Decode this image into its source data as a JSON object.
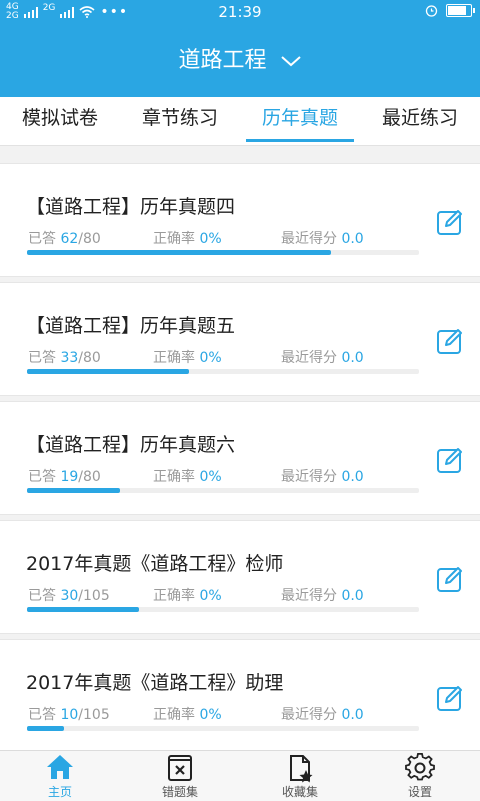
{
  "status_bar": {
    "signal_left": "4G",
    "signal_left2": "2G",
    "signal_mid": "2G",
    "time": "21:39",
    "battery_level": 0.9
  },
  "header": {
    "title": "道路工程"
  },
  "tabs": [
    {
      "label": "模拟试卷",
      "active": false
    },
    {
      "label": "章节练习",
      "active": false
    },
    {
      "label": "历年真题",
      "active": true
    },
    {
      "label": "最近练习",
      "active": false
    }
  ],
  "cards": [
    {
      "title": "【道路工程】历年真题四",
      "answered_label": "已答",
      "answered": "62",
      "total": "80",
      "accuracy_label": "正确率",
      "accuracy": "0%",
      "score_label": "最近得分",
      "score": "0.0",
      "progress": 0.775
    },
    {
      "title": "【道路工程】历年真题五",
      "answered_label": "已答",
      "answered": "33",
      "total": "80",
      "accuracy_label": "正确率",
      "accuracy": "0%",
      "score_label": "最近得分",
      "score": "0.0",
      "progress": 0.4125
    },
    {
      "title": "【道路工程】历年真题六",
      "answered_label": "已答",
      "answered": "19",
      "total": "80",
      "accuracy_label": "正确率",
      "accuracy": "0%",
      "score_label": "最近得分",
      "score": "0.0",
      "progress": 0.2375
    },
    {
      "title": "2017年真题《道路工程》检师",
      "answered_label": "已答",
      "answered": "30",
      "total": "105",
      "accuracy_label": "正确率",
      "accuracy": "0%",
      "score_label": "最近得分",
      "score": "0.0",
      "progress": 0.286
    },
    {
      "title": "2017年真题《道路工程》助理",
      "answered_label": "已答",
      "answered": "10",
      "total": "105",
      "accuracy_label": "正确率",
      "accuracy": "0%",
      "score_label": "最近得分",
      "score": "0.0",
      "progress": 0.095
    }
  ],
  "bottom_nav": [
    {
      "label": "主页",
      "icon": "home-icon",
      "active": true
    },
    {
      "label": "错题集",
      "icon": "wrong-book-icon",
      "active": false
    },
    {
      "label": "收藏集",
      "icon": "favorite-doc-icon",
      "active": false
    },
    {
      "label": "设置",
      "icon": "gear-icon",
      "active": false
    }
  ],
  "colors": {
    "accent": "#2aa6e3",
    "text": "#222222",
    "muted": "#9a9a9a"
  }
}
